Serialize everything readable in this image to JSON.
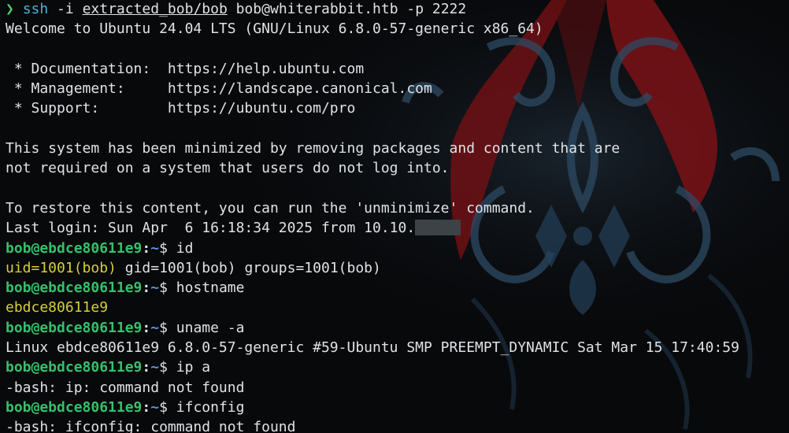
{
  "ssh_cmd": {
    "arrow": "❯",
    "ssh": "ssh",
    "flag": " -i ",
    "keypath": "extracted_bob/bob",
    "target": " bob@whiterabbit.htb -p 2222"
  },
  "motd": {
    "welcome": "Welcome to Ubuntu 24.04 LTS (GNU/Linux 6.8.0-57-generic x86_64)",
    "doc": " * Documentation:  https://help.ubuntu.com",
    "mgmt": " * Management:     https://landscape.canonical.com",
    "support": " * Support:        https://ubuntu.com/pro",
    "minimized_1": "This system has been minimized by removing packages and content that are",
    "minimized_2": "not required on a system that users do not log into.",
    "restore": "To restore this content, you can run the 'unminimize' command.",
    "last_login": "Last login: Sun Apr  6 16:18:34 2025 from 10.10."
  },
  "prompt": {
    "user_host": "bob@ebdce80611e9",
    "colon": ":",
    "cwd": "~",
    "dollar": "$ "
  },
  "session": [
    {
      "command": "id",
      "output": "uid=1001(bob) gid=1001(bob) groups=1001(bob)",
      "output_style": "uid"
    },
    {
      "command": "hostname",
      "output": "ebdce80611e9",
      "output_style": "yellow"
    },
    {
      "command": "uname -a",
      "output": "Linux ebdce80611e9 6.8.0-57-generic #59-Ubuntu SMP PREEMPT_DYNAMIC Sat Mar 15 17:40:59",
      "output_style": "plain"
    },
    {
      "command": "ip a",
      "output": "-bash: ip: command not found",
      "output_style": "plain"
    },
    {
      "command": "ifconfig",
      "output": "-bash: ifconfig: command not found",
      "output_style": "plain"
    }
  ],
  "id_output": {
    "uid": "uid=1001(bob)",
    "rest": " gid=1001(bob) groups=1001(bob)"
  },
  "colors": {
    "background": "#08090b",
    "text": "#dfe3e6",
    "prompt_user": "#35c16a",
    "prompt_cwd": "#5b8fe2",
    "highlight": "#d6cf3a",
    "wallpaper_red": "#8a1418",
    "wallpaper_blue": "#3a5a78"
  }
}
